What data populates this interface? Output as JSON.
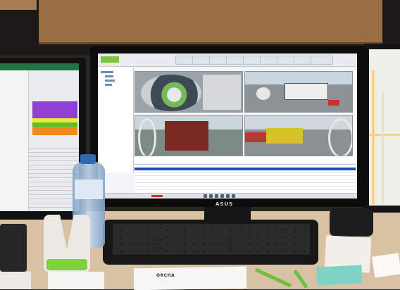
{
  "monitor": {
    "brand": "ASUS"
  },
  "app": {
    "toolbar_buttons": [
      "",
      "",
      "",
      "",
      "",
      "",
      "",
      "",
      ""
    ]
  },
  "desk": {
    "paper_heading": "ORCHA"
  },
  "colors": {
    "selected_row": "#1e4fb8",
    "app_logo": "#7cc243",
    "excel_header": "#217346"
  }
}
